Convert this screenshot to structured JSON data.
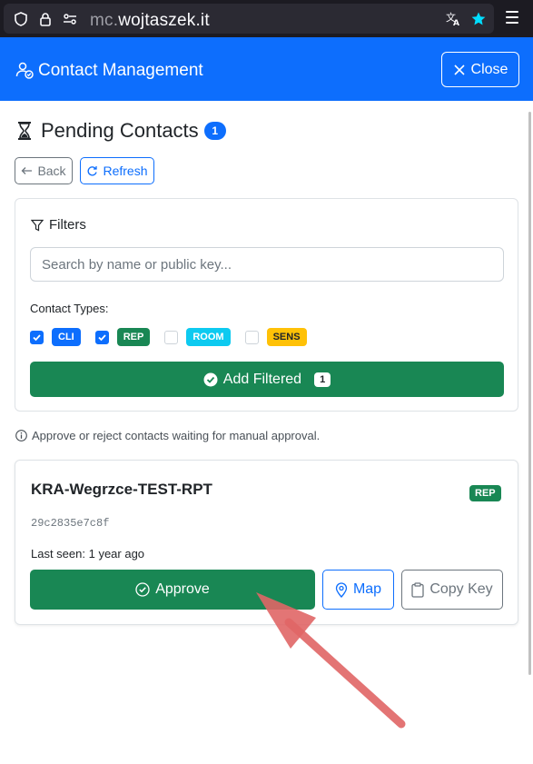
{
  "browser": {
    "url_prefix": "mc.",
    "url_domain": "wojtaszek.it"
  },
  "header": {
    "title": "Contact Management",
    "close_label": "Close"
  },
  "page": {
    "title": "Pending Contacts",
    "count": "1",
    "back_label": "Back",
    "refresh_label": "Refresh"
  },
  "filters": {
    "title": "Filters",
    "search_placeholder": "Search by name or public key...",
    "types_label": "Contact Types:",
    "types": [
      {
        "label": "CLI",
        "checked": true,
        "color": "#0d6efd"
      },
      {
        "label": "REP",
        "checked": true,
        "color": "#198754"
      },
      {
        "label": "ROOM",
        "checked": false,
        "color": "#0dcaf0"
      },
      {
        "label": "SENS",
        "checked": false,
        "color": "#ffc107"
      }
    ],
    "add_label": "Add Filtered",
    "add_count": "1"
  },
  "info_text": "Approve or reject contacts waiting for manual approval.",
  "contact": {
    "name": "KRA-Wegrzce-TEST-RPT",
    "type": "REP",
    "public_key": "29c2835e7c8f",
    "last_seen": "Last seen: 1 year ago",
    "approve_label": "Approve",
    "map_label": "Map",
    "copy_label": "Copy Key"
  },
  "colors": {
    "primary": "#0d6efd",
    "success": "#198754",
    "annotation_arrow": "#e06666"
  }
}
